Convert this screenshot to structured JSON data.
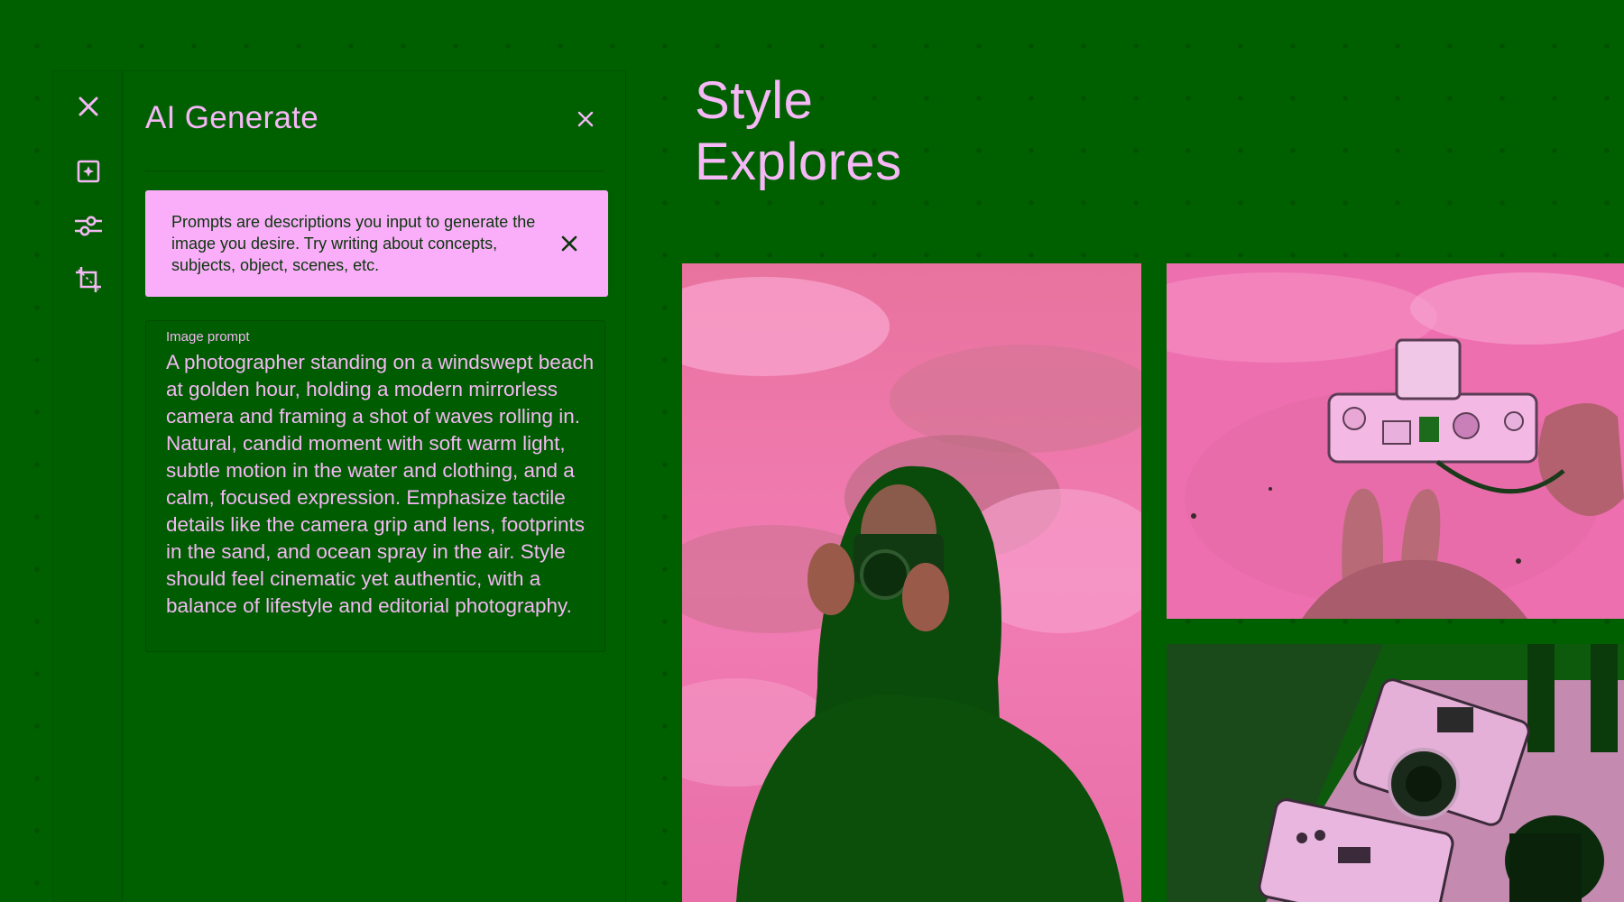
{
  "panel": {
    "title": "AI Generate"
  },
  "info": {
    "text": "Prompts are descriptions you input to generate the image you desire. Try writing about concepts, subjects, object, scenes, etc."
  },
  "prompt": {
    "label": "Image prompt",
    "value": "A photographer standing on a windswept beach at golden hour, holding a modern mirrorless camera and framing a shot of waves rolling in. Natural, candid moment with soft warm light, subtle motion in the water and clothing, and a calm, focused expression. Emphasize tactile details like the camera grip and lens, footprints in the sand, and ocean spray in the air. Style should feel cinematic yet authentic, with a balance of lifestyle and editorial photography."
  },
  "main": {
    "title_line1": "Style",
    "title_line2": "Explores"
  },
  "rail": {
    "items": [
      {
        "icon": "close-icon"
      },
      {
        "icon": "add-image-icon"
      },
      {
        "icon": "sliders-icon"
      },
      {
        "icon": "crop-icon"
      }
    ]
  },
  "colors": {
    "background": "#006000",
    "accent_pink": "#faaefa",
    "text_pink": "#f4b8f4",
    "dark_text": "#0b350b"
  }
}
